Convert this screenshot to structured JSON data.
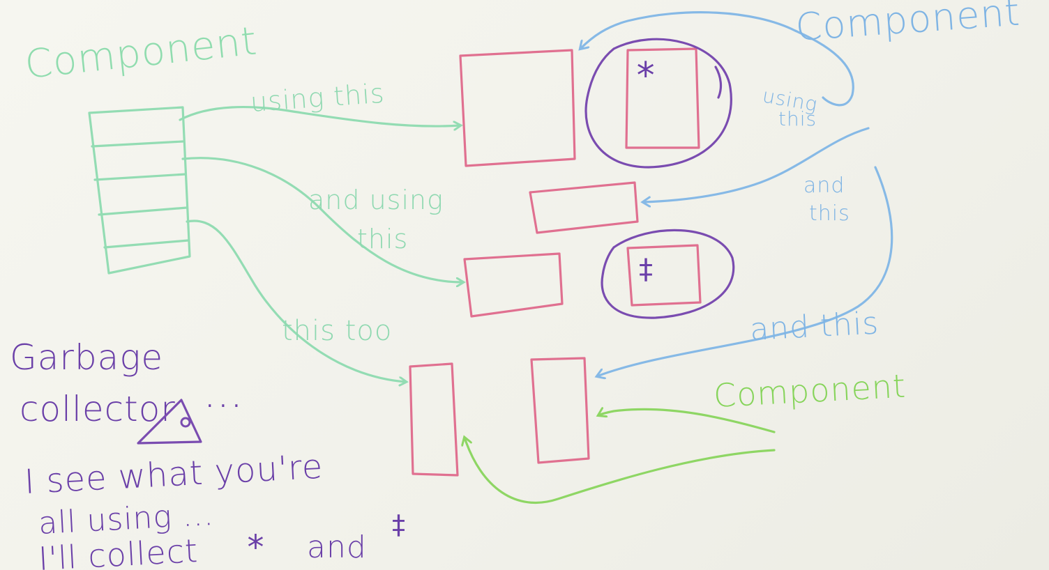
{
  "labels": {
    "component_top_left": "Component",
    "component_top_right": "Component",
    "component_bottom_right": "Component",
    "using_this": "using this",
    "and_using": "and using",
    "this_1": "this",
    "this_too": "this too",
    "using_small": "using",
    "this_small": "this",
    "and_small": "and",
    "this_small2": "this",
    "and_this": "and this",
    "asterisk": "*",
    "dagger": "‡"
  },
  "note": {
    "line1": "Garbage",
    "line2": "collector",
    "line3": "I see what you're",
    "line4": "all using ...",
    "line5a": "I'll collect",
    "line5b": "*",
    "line5c": "and",
    "line5d": "‡",
    "dots": ". . ."
  },
  "colors": {
    "green": "#93dcb3",
    "blue": "#86b9e6",
    "lime": "#8ed664",
    "pink": "#e07090",
    "purple": "#7a4cb0"
  }
}
